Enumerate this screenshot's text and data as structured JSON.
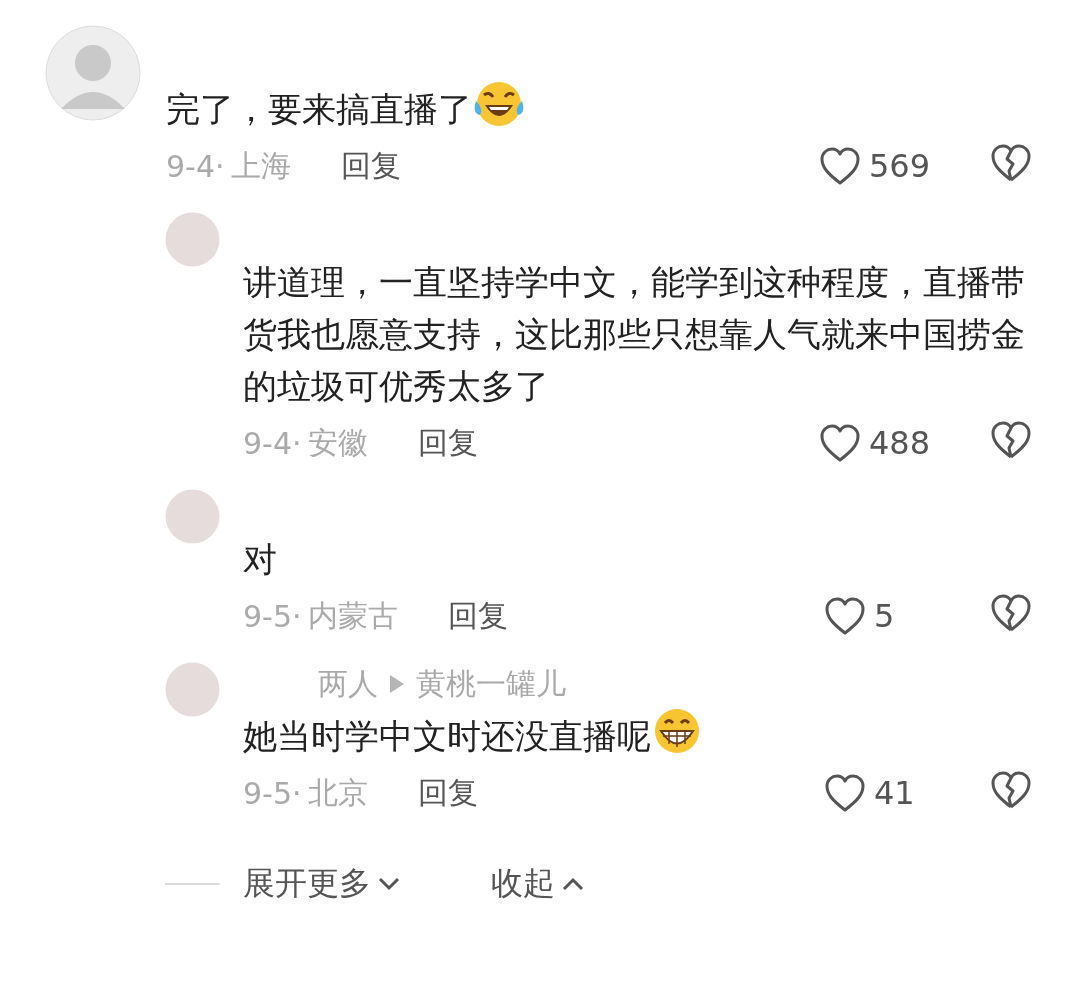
{
  "comments": [
    {
      "kind": "top",
      "text": "完了，要来搞直播了",
      "date": "9-4·",
      "location": "上海",
      "reply": "回复",
      "likes": "569"
    },
    {
      "kind": "reply",
      "text": "讲道理，一直坚持学中文，能学到这种程度，直播带货我也愿意支持，这比那些只想靠人气就来中国捞金的垃圾可优秀太多了",
      "date": "9-4·",
      "location": "安徽",
      "reply": "回复",
      "likes": "488"
    },
    {
      "kind": "reply",
      "text": "对",
      "date": "9-5·",
      "location": "内蒙古",
      "reply": "回复",
      "likes": "5"
    },
    {
      "kind": "reply",
      "author": "两人",
      "reply_to": "黄桃一罐儿",
      "text": "她当时学中文时还没直播呢",
      "date": "9-5·",
      "location": "北京",
      "reply": "回复",
      "likes": "41"
    }
  ],
  "footer": {
    "expand": "展开更多",
    "collapse": "收起"
  }
}
